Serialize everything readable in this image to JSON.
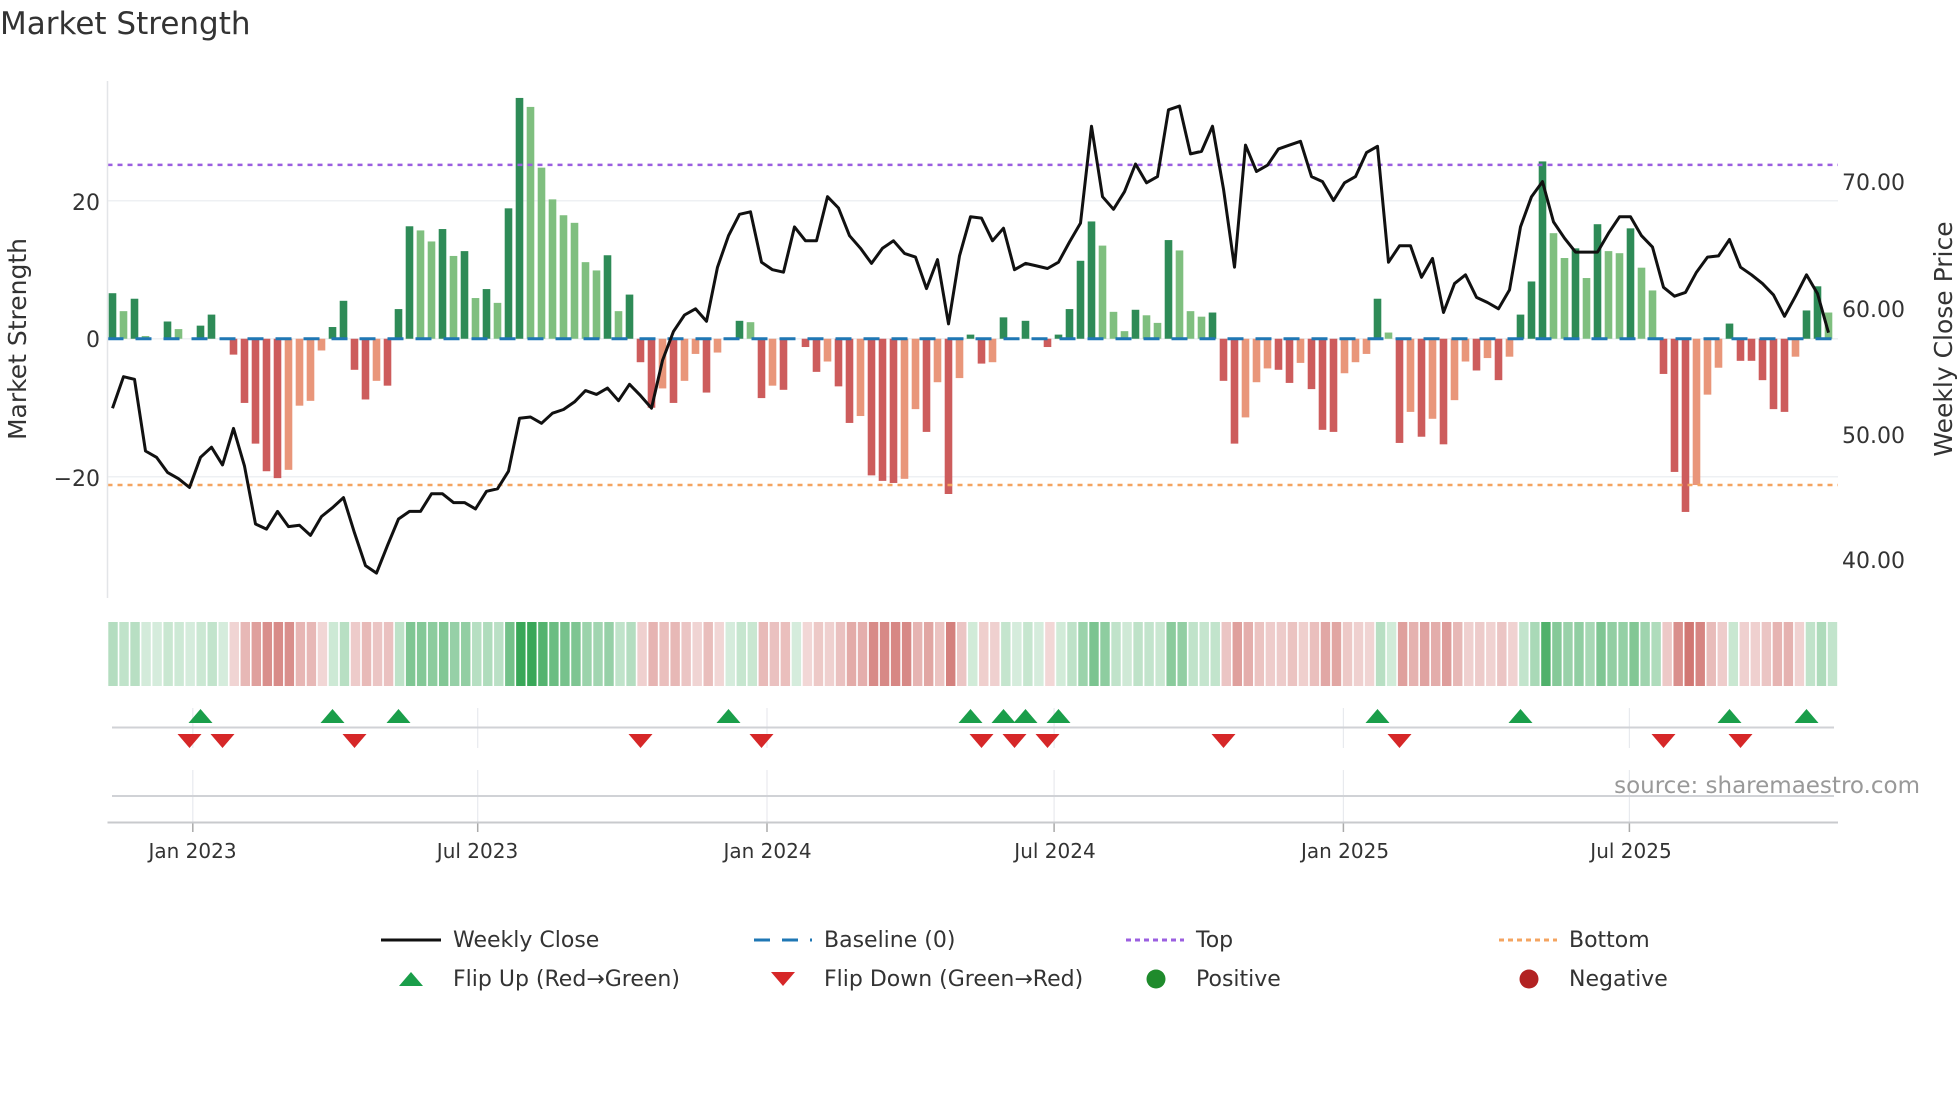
{
  "title": "Market Strength",
  "source": "source: sharemaestro.com",
  "colors": {
    "pos_rising": "#2e8b57",
    "pos_falling": "#7fbf7f",
    "neg_falling": "#cd5c5c",
    "neg_rising": "#e9967a",
    "price_line": "#111111",
    "baseline": "#1f77b4",
    "top": "#9b5fe0",
    "bottom": "#f4a460",
    "flip_up": "#1a9e4a",
    "flip_down": "#d62728",
    "positive": "#1f8b2c",
    "negative": "#b22222"
  },
  "legend": {
    "weekly_close": "Weekly Close",
    "baseline": "Baseline (0)",
    "top": "Top",
    "bottom": "Bottom",
    "flip_up": "Flip Up (Red→Green)",
    "flip_down": "Flip Down (Green→Red)",
    "positive": "Positive",
    "negative": "Negative"
  },
  "chart_data": {
    "type": "bar+line",
    "title": "Market Strength",
    "ylabel": "Market Strength",
    "y2label": "Weekly Close Price",
    "ylim": [
      -37,
      37
    ],
    "y2lim": [
      35.5,
      79
    ],
    "yticks": [
      "20",
      "0",
      "−20"
    ],
    "yticks_values": [
      20,
      0,
      -20
    ],
    "y2ticks": [
      "70.00",
      "60.00",
      "50.00",
      "40.00"
    ],
    "y2ticks_values": [
      70,
      60,
      50,
      40
    ],
    "xticks": [
      "Jan 2023",
      "Jul 2023",
      "Jan 2024",
      "Jul 2024",
      "Jan 2025",
      "Jul 2025"
    ],
    "xticks_week_index": [
      7.3,
      33.2,
      59.5,
      85.6,
      111.9,
      137.9
    ],
    "top_threshold": 25.2,
    "bottom_threshold": -21.2,
    "baseline": 0,
    "strength": [
      6.6,
      4.0,
      5.8,
      0.4,
      0,
      2.5,
      1.4,
      0,
      1.9,
      3.5,
      0,
      -2.3,
      -9.3,
      -15.2,
      -19.2,
      -20.2,
      -19.0,
      -9.7,
      -9.0,
      -1.7,
      1.7,
      5.5,
      -4.5,
      -8.8,
      -6.1,
      -6.8,
      4.3,
      16.3,
      15.7,
      14.1,
      15.9,
      12.0,
      12.7,
      5.9,
      7.2,
      5.2,
      18.9,
      34.9,
      33.6,
      24.8,
      20.2,
      17.9,
      16.8,
      11.1,
      9.9,
      12.1,
      4.0,
      6.4,
      -3.4,
      -10.0,
      -7.2,
      -9.3,
      -6.1,
      -2.2,
      -7.8,
      -2.0,
      0,
      2.6,
      2.4,
      -8.6,
      -6.8,
      -7.4,
      0,
      -1.2,
      -4.8,
      -3.3,
      -6.9,
      -12.2,
      -11.2,
      -19.8,
      -20.6,
      -20.9,
      -20.3,
      -10.2,
      -13.5,
      -6.3,
      -22.5,
      -5.7,
      0.6,
      -3.6,
      -3.4,
      3.1,
      0,
      2.6,
      0.1,
      -1.2,
      0.6,
      4.3,
      11.3,
      17.0,
      13.5,
      3.9,
      1.1,
      4.2,
      3.4,
      2.3,
      14.3,
      12.8,
      4.0,
      3.2,
      3.8,
      -6.1,
      -15.2,
      -11.4,
      -6.3,
      -4.3,
      -4.5,
      -6.4,
      -3.5,
      -7.3,
      -13.2,
      -13.5,
      -5.0,
      -3.4,
      -2.2,
      5.8,
      0.9,
      -15.1,
      -10.6,
      -14.2,
      -11.6,
      -15.3,
      -8.9,
      -3.3,
      -4.6,
      -2.8,
      -6.0,
      -2.6,
      3.5,
      8.3,
      25.7,
      15.3,
      11.7,
      13.1,
      8.8,
      16.6,
      12.7,
      12.4,
      16.0,
      10.3,
      7.0,
      -5.1,
      -19.3,
      -25.1,
      -21.2,
      -8.1,
      -4.2,
      2.2,
      -3.2,
      -3.2,
      -6.0,
      -10.2,
      -10.6,
      -2.6,
      4.1,
      7.6,
      3.8
    ],
    "weekly_close": [
      52.1,
      54.6,
      54.4,
      48.7,
      48.2,
      47.0,
      46.5,
      45.8,
      48.2,
      49.0,
      47.6,
      50.5,
      47.5,
      42.9,
      42.5,
      43.9,
      42.7,
      42.8,
      42.0,
      43.5,
      44.2,
      45.0,
      42.2,
      39.6,
      39.0,
      41.2,
      43.3,
      43.9,
      43.9,
      45.3,
      45.3,
      44.6,
      44.6,
      44.1,
      45.5,
      45.7,
      47.1,
      51.3,
      51.4,
      50.9,
      51.7,
      52.0,
      52.6,
      53.5,
      53.2,
      53.7,
      52.7,
      54.0,
      53.1,
      52.1,
      55.9,
      58.2,
      59.5,
      60.0,
      59.0,
      63.3,
      65.8,
      67.5,
      67.7,
      63.7,
      63.1,
      62.9,
      66.5,
      65.4,
      65.4,
      68.9,
      68.0,
      65.8,
      64.8,
      63.6,
      64.8,
      65.4,
      64.4,
      64.1,
      61.6,
      63.9,
      58.8,
      64.2,
      67.3,
      67.2,
      65.4,
      66.4,
      63.1,
      63.6,
      63.4,
      63.2,
      63.7,
      65.3,
      66.8,
      74.5,
      68.9,
      67.9,
      69.3,
      71.5,
      70.0,
      70.5,
      75.8,
      76.1,
      72.3,
      72.5,
      74.5,
      69.5,
      63.3,
      73.0,
      70.9,
      71.4,
      72.7,
      73.0,
      73.3,
      70.5,
      70.1,
      68.6,
      70.0,
      70.5,
      72.4,
      72.9,
      63.7,
      65.0,
      65.0,
      62.5,
      64.0,
      59.7,
      62.0,
      62.7,
      60.9,
      60.5,
      60.0,
      61.5,
      66.5,
      68.9,
      70.1,
      66.9,
      65.6,
      64.5,
      64.5,
      64.5,
      66.0,
      67.3,
      67.3,
      65.8,
      64.9,
      61.7,
      61.0,
      61.3,
      62.9,
      64.1,
      64.2,
      65.5,
      63.3,
      62.7,
      62.0,
      61.1,
      59.4,
      61.0,
      62.7,
      61.2,
      58.1
    ],
    "flip_up_week_index": [
      8,
      20,
      26,
      56,
      78,
      81,
      83,
      86,
      115,
      128,
      147,
      154
    ],
    "flip_down_week_index": [
      7,
      10,
      22,
      48,
      59,
      79,
      82,
      85,
      101,
      117,
      141,
      148
    ],
    "legend_position": "bottom"
  }
}
